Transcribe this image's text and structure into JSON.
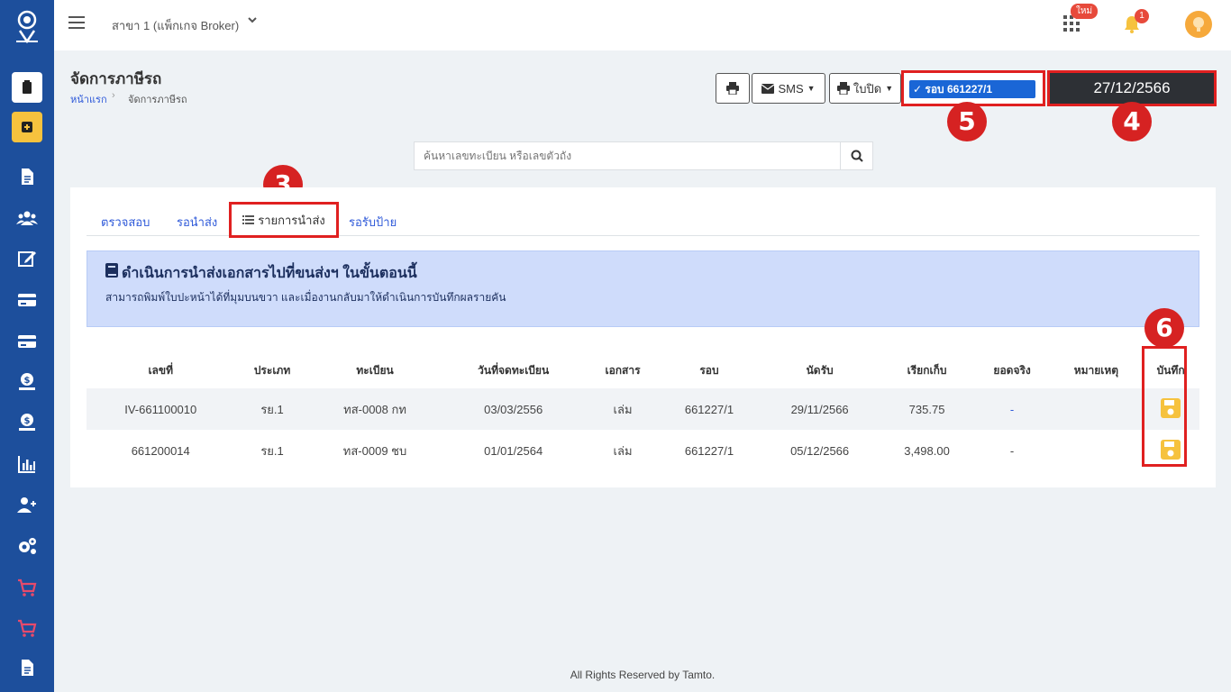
{
  "topbar": {
    "branch": "สาขา 1 (แพ็กเกจ Broker)",
    "new_badge": "ใหม่",
    "notification_count": "1"
  },
  "header": {
    "title": "จัดการภาษีรถ",
    "breadcrumb_home": "หน้าแรก",
    "breadcrumb_current": "จัดการภาษีรถ"
  },
  "toolbar": {
    "sms_label": "SMS",
    "bp_label": "ใบปิด",
    "round_selected": "✓ รอบ 661227/1",
    "date_value": "27/12/2566"
  },
  "markers": {
    "m3": "3",
    "m4": "4",
    "m5": "5",
    "m6": "6"
  },
  "search": {
    "placeholder": "ค้นหาเลขทะเบียน หรือเลขตัวถัง"
  },
  "tabs": {
    "check": "ตรวจสอบ",
    "pending_send": "รอนำส่ง",
    "send_list": "รายการนำส่ง",
    "pending_sticker": "รอรับป้าย"
  },
  "alert": {
    "title": "ดำเนินการนำส่งเอกสารไปที่ขนส่งฯ ในขั้นตอนนี้",
    "subtitle": "สามารถพิมพ์ใบปะหน้าได้ที่มุมบนขวา และเมื่องานกลับมาให้ดำเนินการบันทึกผลรายคัน"
  },
  "table": {
    "headers": [
      "เลขที่",
      "ประเภท",
      "ทะเบียน",
      "วันที่จดทะเบียน",
      "เอกสาร",
      "รอบ",
      "นัดรับ",
      "เรียกเก็บ",
      "ยอดจริง",
      "หมายเหตุ",
      "บันทึก"
    ],
    "rows": [
      [
        "IV-661100010",
        "รย.1",
        "ทส-0008 กท",
        "03/03/2556",
        "เล่ม",
        "661227/1",
        "29/11/2566",
        "735.75",
        "-",
        ""
      ],
      [
        "661200014",
        "รย.1",
        "ทส-0009 ชบ",
        "01/01/2564",
        "เล่ม",
        "661227/1",
        "05/12/2566",
        "3,498.00",
        "-",
        ""
      ]
    ]
  },
  "footer": "All Rights Reserved by Tamto.",
  "colors": {
    "sidebar": "#1d4f9c",
    "accent": "#2e59d9",
    "highlight": "#e02020",
    "save": "#f6c23e"
  }
}
